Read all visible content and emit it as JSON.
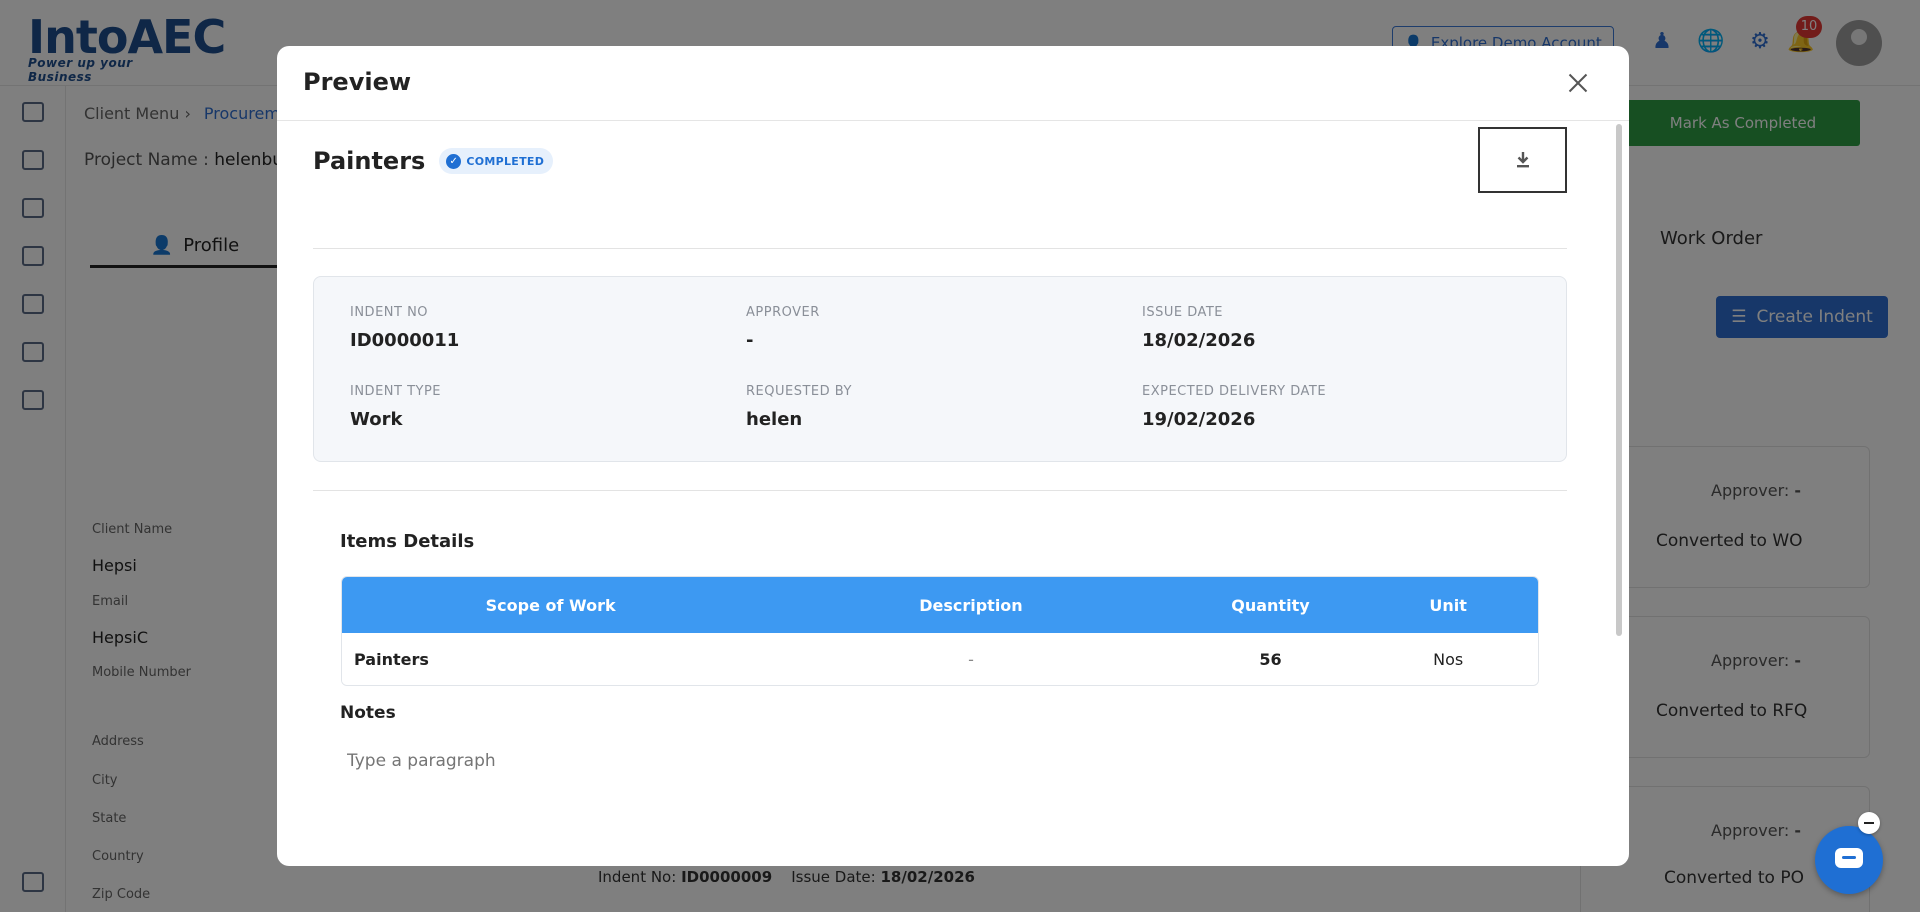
{
  "background": {
    "logo": {
      "word": "IntoAEC",
      "tagline": "Power up your Business"
    },
    "explore_demo": "Explore Demo Account",
    "notification_count": "10",
    "breadcrumb": {
      "root": "Client Menu",
      "current": "Procurem"
    },
    "project_label": "Project Name :",
    "project_value": "helenbuil",
    "mark_completed": "Mark As Completed",
    "profile_tab": "Profile",
    "work_order_tab": "Work Order",
    "create_indent": "Create Indent",
    "fields": [
      {
        "label": "Client Name",
        "value": "Hepsi"
      },
      {
        "label": "Email",
        "value": "HepsiC"
      },
      {
        "label": "Mobile Number",
        "value": ""
      },
      {
        "label": "Address",
        "value": ""
      },
      {
        "label": "City",
        "value": ""
      },
      {
        "label": "State",
        "value": ""
      },
      {
        "label": "Country",
        "value": ""
      },
      {
        "label": "Zip Code",
        "value": ""
      }
    ],
    "cards": [
      {
        "approver_label": "Approver:",
        "approver": "-",
        "status": "Converted to WO"
      },
      {
        "approver_label": "Approver:",
        "approver": "-",
        "status": "Converted to RFQ"
      },
      {
        "approver_label": "Approver:",
        "approver": "-",
        "status": "Converted to PO"
      }
    ],
    "bottom_indent_label": "Indent No:",
    "bottom_indent_no": "ID0000009",
    "bottom_issue_label": "Issue Date:",
    "bottom_issue_date": "18/02/2026"
  },
  "modal": {
    "title": "Preview",
    "doc_title": "Painters",
    "status": "COMPLETED",
    "info": {
      "indent_no_label": "INDENT NO",
      "indent_no": "ID0000011",
      "approver_label": "APPROVER",
      "approver": "-",
      "issue_date_label": "ISSUE DATE",
      "issue_date": "18/02/2026",
      "indent_type_label": "INDENT TYPE",
      "indent_type": "Work",
      "requested_by_label": "REQUESTED BY",
      "requested_by": "helen",
      "expected_delivery_label": "EXPECTED DELIVERY DATE",
      "expected_delivery": "19/02/2026"
    },
    "items_title": "Items Details",
    "table": {
      "headers": [
        "Scope of Work",
        "Description",
        "Quantity",
        "Unit"
      ],
      "rows": [
        [
          "Painters",
          "-",
          "56",
          "Nos"
        ]
      ]
    },
    "notes_title": "Notes",
    "notes_placeholder": "Type a paragraph"
  },
  "colors": {
    "accent": "#3d99f2",
    "primary": "#1f6fd3",
    "success": "#2e9e45",
    "badge_bg": "#e6f0fc"
  }
}
